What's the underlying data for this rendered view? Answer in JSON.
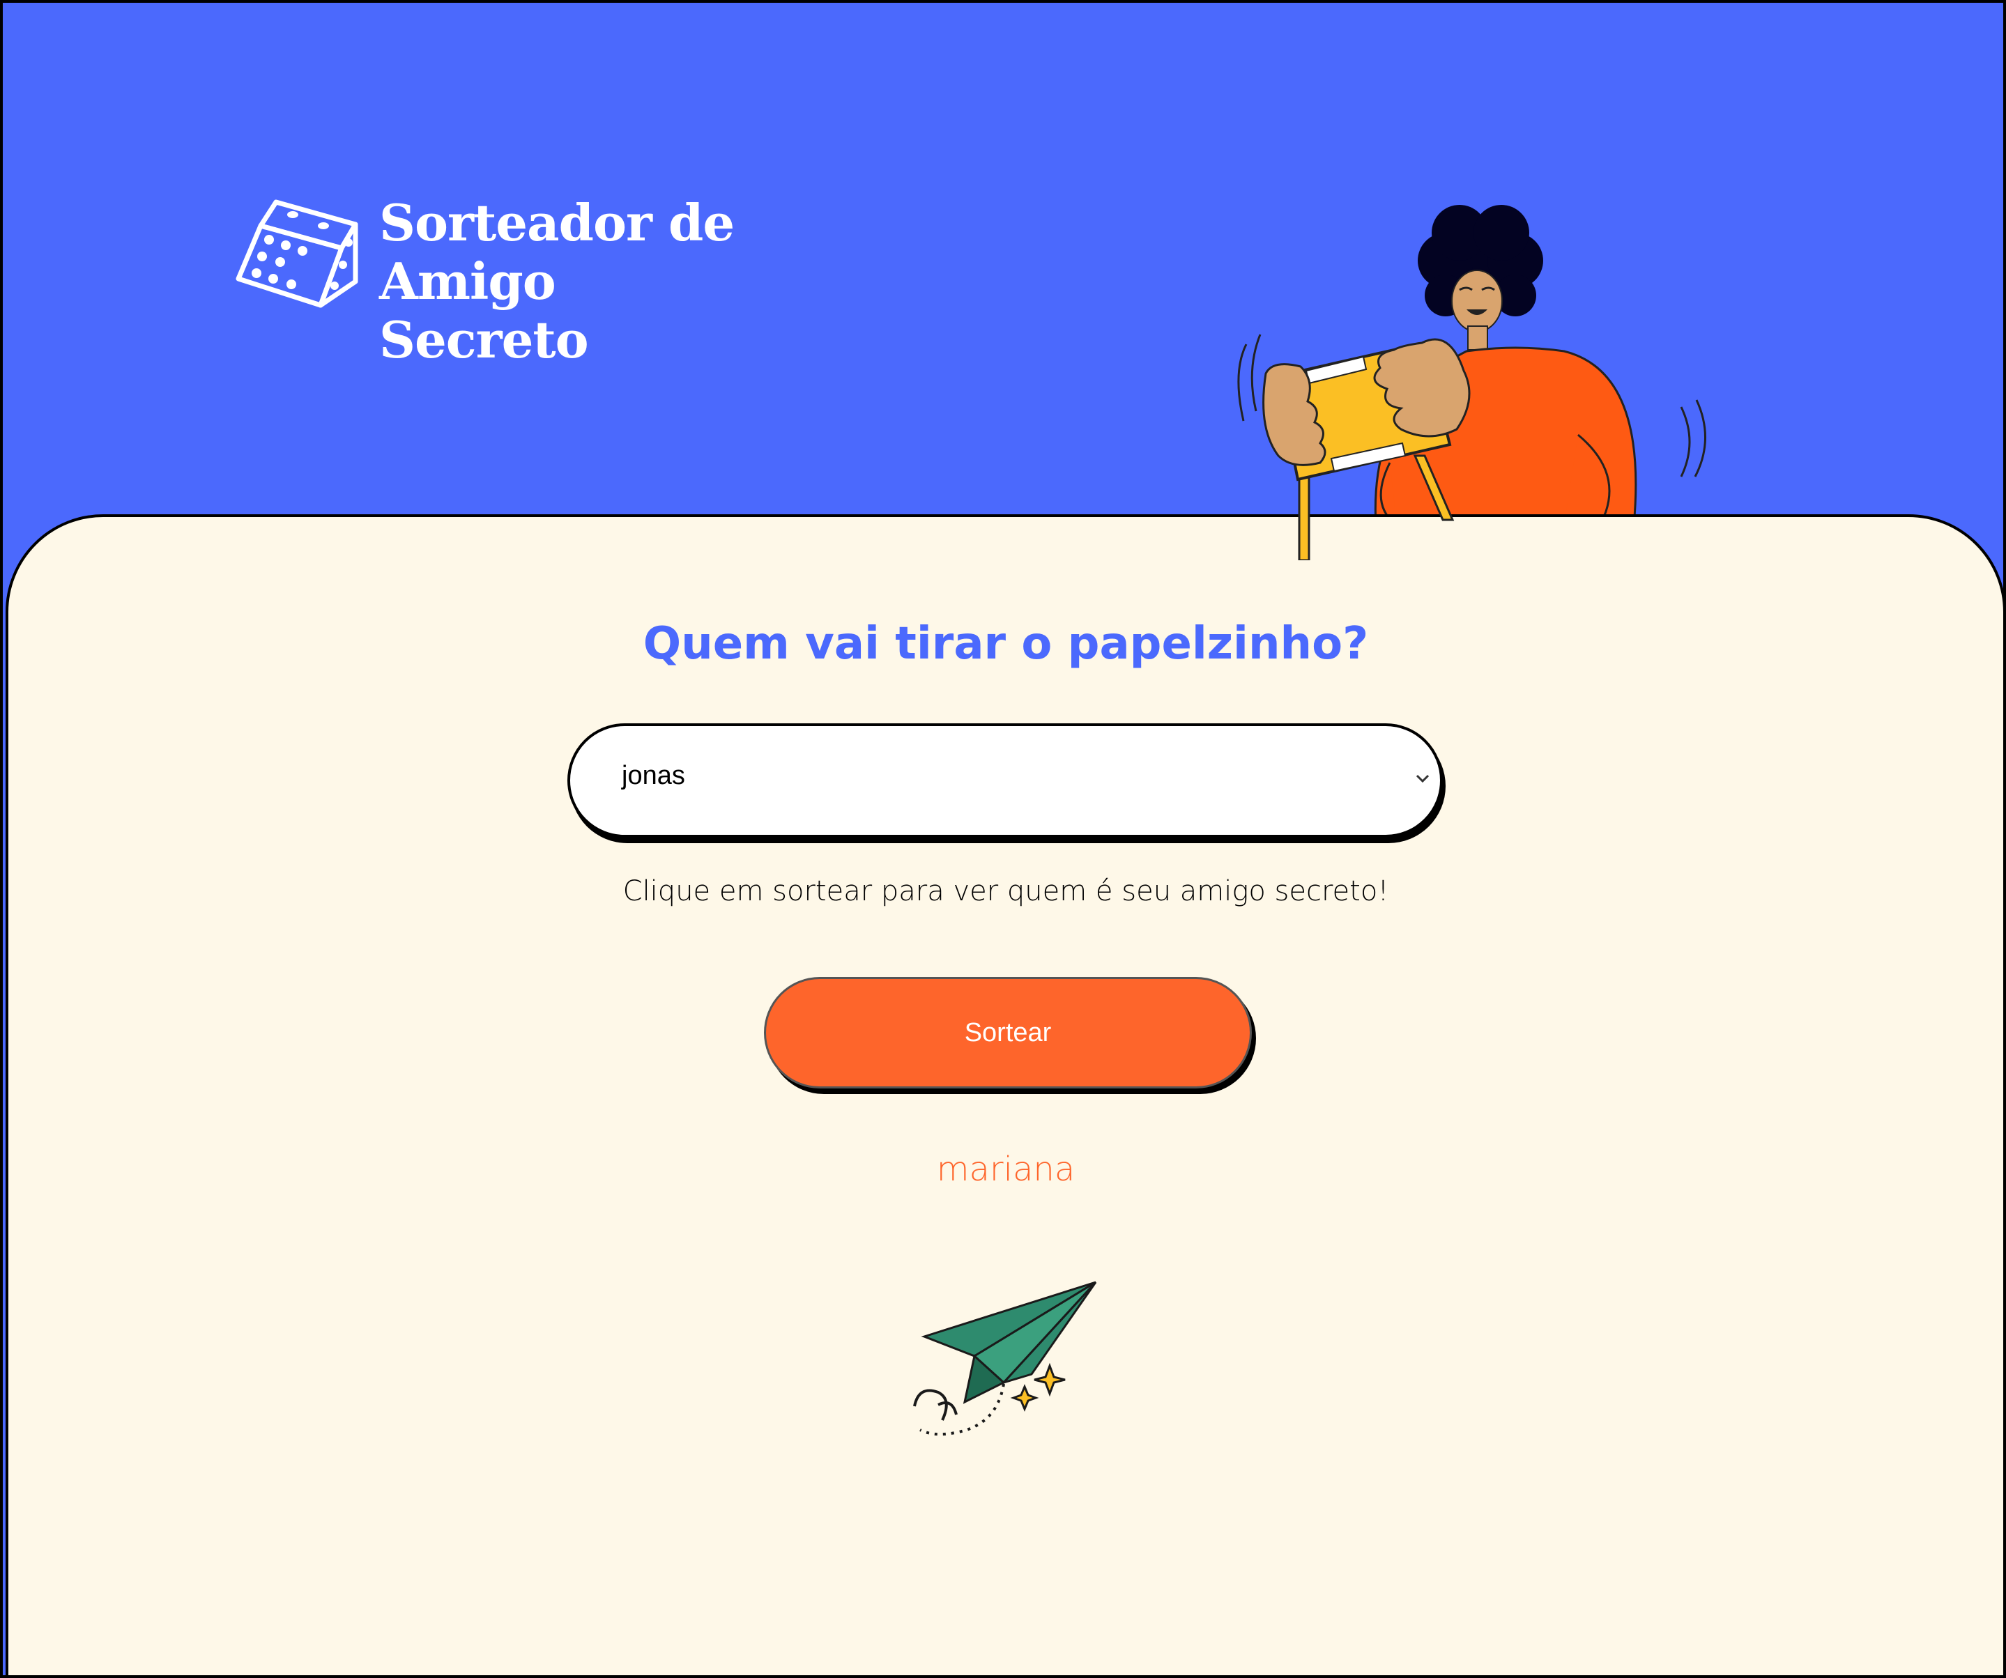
{
  "header": {
    "logo_line1": "Sorteador de",
    "logo_line2": "Amigo Secreto",
    "logo_icon": "dice-icon",
    "illustration": "person-holding-gift-illustration"
  },
  "main": {
    "heading": "Quem vai tirar o papelzinho?",
    "select": {
      "selected": "jonas",
      "icon": "chevron-down-icon"
    },
    "hint": "Clique em sortear para ver quem é seu amigo secreto!",
    "button_label": "Sortear",
    "result": "mariana",
    "decoration": "paper-plane-icon"
  },
  "colors": {
    "primary_blue": "#4B69FD",
    "accent_orange": "#FE652B",
    "panel_cream": "#FEF8E8"
  }
}
